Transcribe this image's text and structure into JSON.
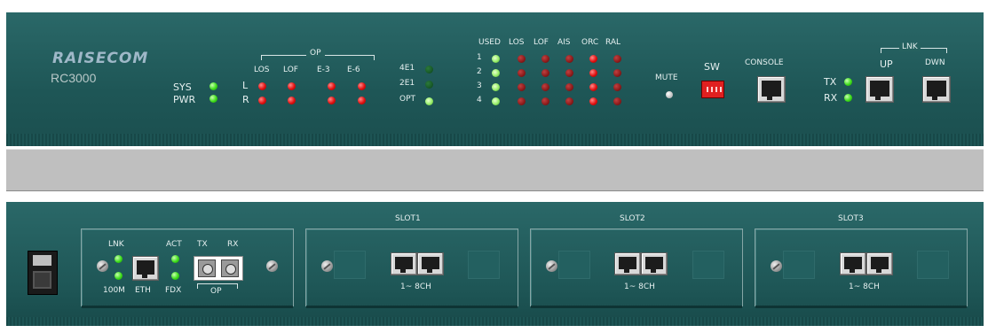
{
  "brand": "RAISECOM",
  "model": "RC3000",
  "colors": {
    "panel": "#1f5a5a",
    "led_green": "#3ddc1a",
    "led_red": "#e01010",
    "strip": "#bfbfbf"
  },
  "status": {
    "sys": "SYS",
    "pwr": "PWR"
  },
  "op_section": {
    "group_label": "OP",
    "columns": [
      "LOS",
      "LOF",
      "E-3",
      "E-6"
    ],
    "rows": [
      "L",
      "R"
    ]
  },
  "mode": {
    "labels": [
      "4E1",
      "2E1",
      "OPT"
    ]
  },
  "channel_grid": {
    "columns": [
      "USED",
      "LOS",
      "LOF",
      "AIS",
      "ORC",
      "RAL"
    ],
    "rows": [
      "1",
      "2",
      "3",
      "4"
    ]
  },
  "mute": {
    "label": "MUTE"
  },
  "sw": {
    "label": "SW"
  },
  "console": {
    "label": "CONSOLE"
  },
  "link": {
    "group_label": "LNK",
    "up": "UP",
    "down": "DWN",
    "tx": "TX",
    "rx": "RX"
  },
  "eth_module": {
    "lnk": "LNK",
    "speed": "100M",
    "eth": "ETH",
    "act": "ACT",
    "fdx": "FDX",
    "tx": "TX",
    "rx": "RX",
    "op": "OP"
  },
  "slots": [
    {
      "name": "SLOT1",
      "channels": "1~ 8CH"
    },
    {
      "name": "SLOT2",
      "channels": "1~ 8CH"
    },
    {
      "name": "SLOT3",
      "channels": "1~ 8CH"
    }
  ]
}
